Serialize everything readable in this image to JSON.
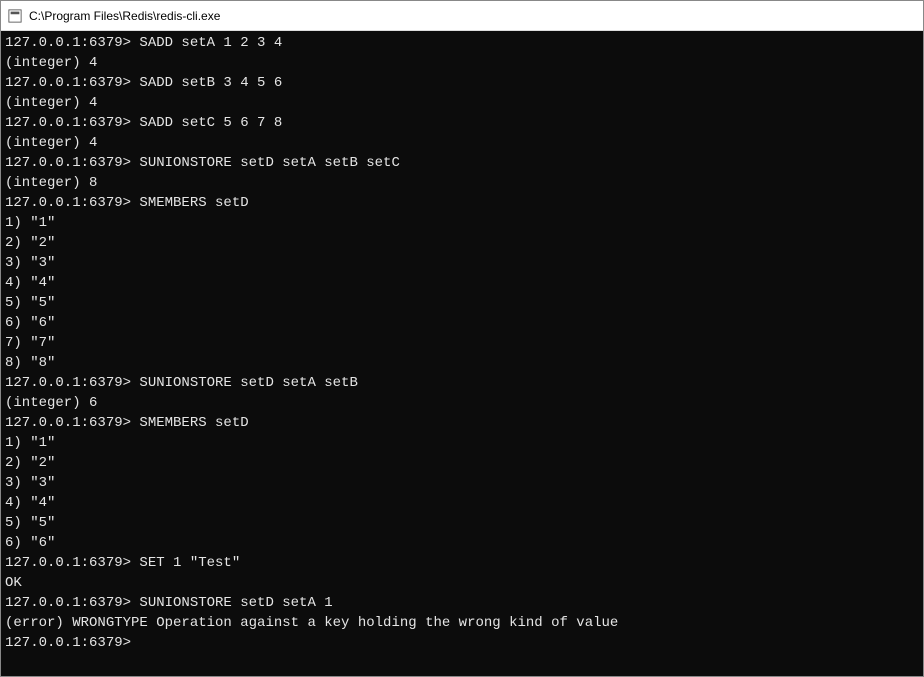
{
  "window": {
    "title": "C:\\Program Files\\Redis\\redis-cli.exe"
  },
  "prompt": "127.0.0.1:6379>",
  "lines": [
    "127.0.0.1:6379> SADD setA 1 2 3 4",
    "(integer) 4",
    "127.0.0.1:6379> SADD setB 3 4 5 6",
    "(integer) 4",
    "127.0.0.1:6379> SADD setC 5 6 7 8",
    "(integer) 4",
    "127.0.0.1:6379> SUNIONSTORE setD setA setB setC",
    "(integer) 8",
    "127.0.0.1:6379> SMEMBERS setD",
    "1) \"1\"",
    "2) \"2\"",
    "3) \"3\"",
    "4) \"4\"",
    "5) \"5\"",
    "6) \"6\"",
    "7) \"7\"",
    "8) \"8\"",
    "127.0.0.1:6379> SUNIONSTORE setD setA setB",
    "(integer) 6",
    "127.0.0.1:6379> SMEMBERS setD",
    "1) \"1\"",
    "2) \"2\"",
    "3) \"3\"",
    "4) \"4\"",
    "5) \"5\"",
    "6) \"6\"",
    "127.0.0.1:6379> SET 1 \"Test\"",
    "OK",
    "127.0.0.1:6379> SUNIONSTORE setD setA 1",
    "(error) WRONGTYPE Operation against a key holding the wrong kind of value",
    "127.0.0.1:6379>"
  ]
}
